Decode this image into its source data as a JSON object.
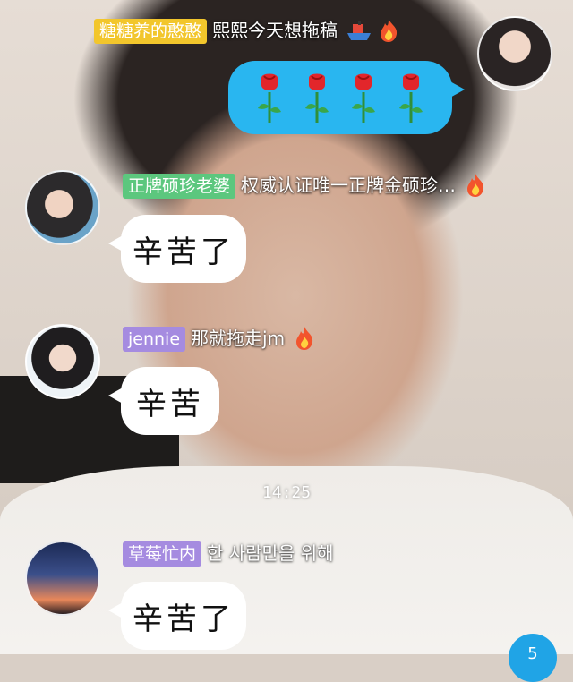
{
  "messages": [
    {
      "name": "糖糖养的憨憨",
      "text": "熙熙今天想拖稿",
      "tag_color": "#f2c62c"
    },
    {
      "name": "正牌硕珍老婆",
      "text": "权威认证唯一正牌金硕珍…",
      "tag_color": "#5cc77e"
    },
    {
      "name": "jennie",
      "text": "那就拖走jm",
      "tag_color": "#a58be0"
    },
    {
      "name": "草莓忙内",
      "text": "한 사람만을 위해",
      "tag_color": "#a58be0"
    }
  ],
  "replies": {
    "first": "辛苦了",
    "second": "辛苦",
    "third": "辛苦了"
  },
  "timestamp": "14:25",
  "unread_badge": "5",
  "icons": {
    "fire": "fire-icon",
    "rose": "rose-icon",
    "ship": "ship-icon"
  },
  "colors": {
    "outgoing_bubble": "#29b6f0",
    "incoming_bubble": "#ffffff"
  }
}
